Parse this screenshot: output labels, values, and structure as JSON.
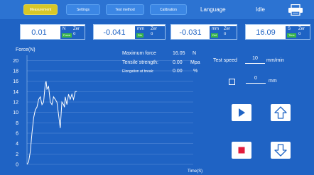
{
  "nav": {
    "tabs": [
      {
        "label": "Measurement",
        "active": true
      },
      {
        "label": "Settings",
        "active": false
      },
      {
        "label": "Test method",
        "active": false
      },
      {
        "label": "Calibration",
        "active": false
      }
    ],
    "language": "Language",
    "status": "Idle",
    "print_icon": "printer-icon"
  },
  "readouts": [
    {
      "value": "0.01",
      "unit": "N",
      "tag": "Force",
      "zero": "Zer\no"
    },
    {
      "value": "-0.041",
      "unit": "mm",
      "tag": "Dis",
      "zero": "Zer\no"
    },
    {
      "value": "-0.031",
      "unit": "mm",
      "tag": "Def",
      "zero": "Zer\no"
    },
    {
      "value": "16.09",
      "unit": "S",
      "tag": "Time",
      "zero": "Zer\no"
    }
  ],
  "results": {
    "max_force_label": "Maximum force",
    "max_force_value": "16.05",
    "max_force_unit": "N",
    "tensile_label": "Tensile strength:",
    "tensile_value": "0.00",
    "tensile_unit": "Mpa",
    "elong_label": "Elongation at break:",
    "elong_value": "0.00",
    "elong_unit": "%"
  },
  "controls": {
    "speed_label": "Test speed",
    "speed_value": "10",
    "speed_unit": "mm/min",
    "pos_value": "0",
    "pos_unit": "mm",
    "play_icon": "play-icon",
    "up_icon": "arrow-up-icon",
    "stop_icon": "stop-icon",
    "down_icon": "arrow-down-icon"
  },
  "chart_data": {
    "type": "line",
    "ylabel": "Force(N)",
    "xlabel": "Time(S)",
    "y_ticks": [
      0,
      2,
      4,
      6,
      8,
      10,
      12,
      14,
      16,
      18,
      20
    ],
    "ylim": [
      0,
      21
    ],
    "xlim": [
      0,
      100
    ],
    "grid": true,
    "series": [
      {
        "x": [
          0,
          1,
          2,
          3,
          4,
          5,
          6,
          7,
          8,
          9,
          10,
          11,
          11.5,
          12,
          13,
          14,
          15,
          16,
          17,
          18,
          19,
          20,
          21,
          22,
          22.5,
          23,
          24,
          25,
          26,
          27,
          28,
          29,
          30
        ],
        "y": [
          0,
          0.5,
          2.5,
          6,
          9,
          10.5,
          11,
          12.5,
          13,
          11.5,
          12,
          15.5,
          16,
          14.5,
          15,
          12,
          11.5,
          13,
          12.5,
          12,
          9.5,
          7,
          12,
          11.5,
          11,
          13,
          11.5,
          13.5,
          12.5,
          13.5,
          12.5,
          14,
          14
        ]
      }
    ]
  }
}
